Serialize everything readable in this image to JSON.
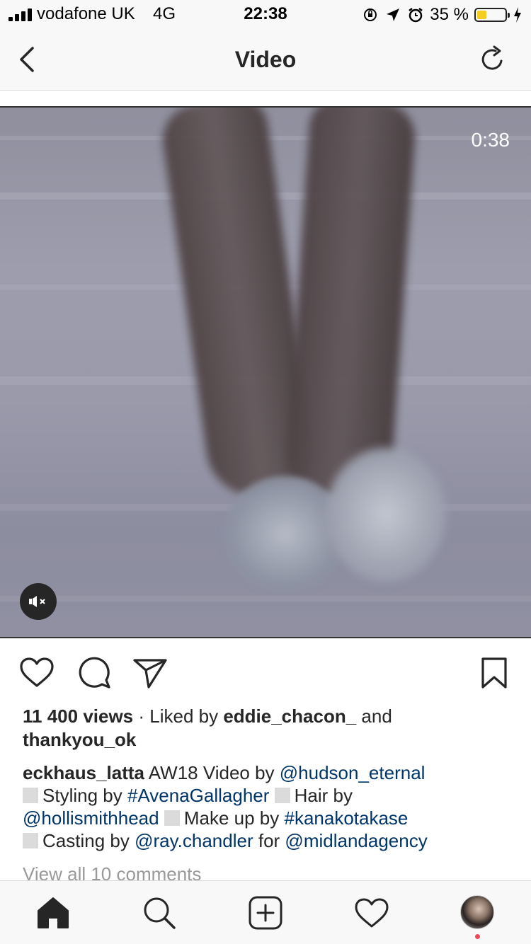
{
  "status_bar": {
    "carrier": "vodafone UK",
    "network": "4G",
    "time": "22:38",
    "battery_percent": "35 %",
    "battery_level": 0.35,
    "battery_color": "#f5cd20",
    "icons": [
      "signal-icon",
      "orientation-lock-icon",
      "location-icon",
      "alarm-icon",
      "battery-icon",
      "charging-icon"
    ]
  },
  "nav": {
    "title": "Video",
    "back_icon": "chevron-left-icon",
    "refresh_icon": "refresh-icon"
  },
  "video": {
    "duration": "0:38",
    "muted": true,
    "mute_icon": "speaker-muted-icon"
  },
  "actions": {
    "icons": [
      "heart-icon",
      "comment-icon",
      "send-icon",
      "bookmark-icon"
    ]
  },
  "post": {
    "views": "11 400 views",
    "liked_by_prefix": " · Liked by ",
    "liked_user_1": "eddie_chacon_",
    "liked_and": " and",
    "liked_user_2": "thankyou_ok",
    "caption": {
      "username": "eckhaus_latta",
      "part1": " AW18 Video by ",
      "mention_video": "@hudson_eternal",
      "styling_label": "Styling by ",
      "hashtag_styling": "#AvenaGallagher",
      "hair_label": "Hair by",
      "mention_hair": "@hollismithhead",
      "makeup_label": "Make up by ",
      "hashtag_makeup": "#kanakotakase",
      "casting_label": "Casting by ",
      "mention_casting": "@ray.chandler",
      "for_label": " for ",
      "mention_agency": "@midlandagency"
    },
    "view_comments": "View all 10 comments"
  },
  "tab_bar": {
    "items": [
      "home-icon",
      "search-icon",
      "new-post-icon",
      "activity-icon",
      "profile-avatar"
    ],
    "active": "home",
    "notification_dot_color": "#ed4956"
  },
  "colors": {
    "link": "#003569",
    "text": "#262626",
    "muted": "#999999",
    "bar_bg": "#f8f8f8"
  }
}
